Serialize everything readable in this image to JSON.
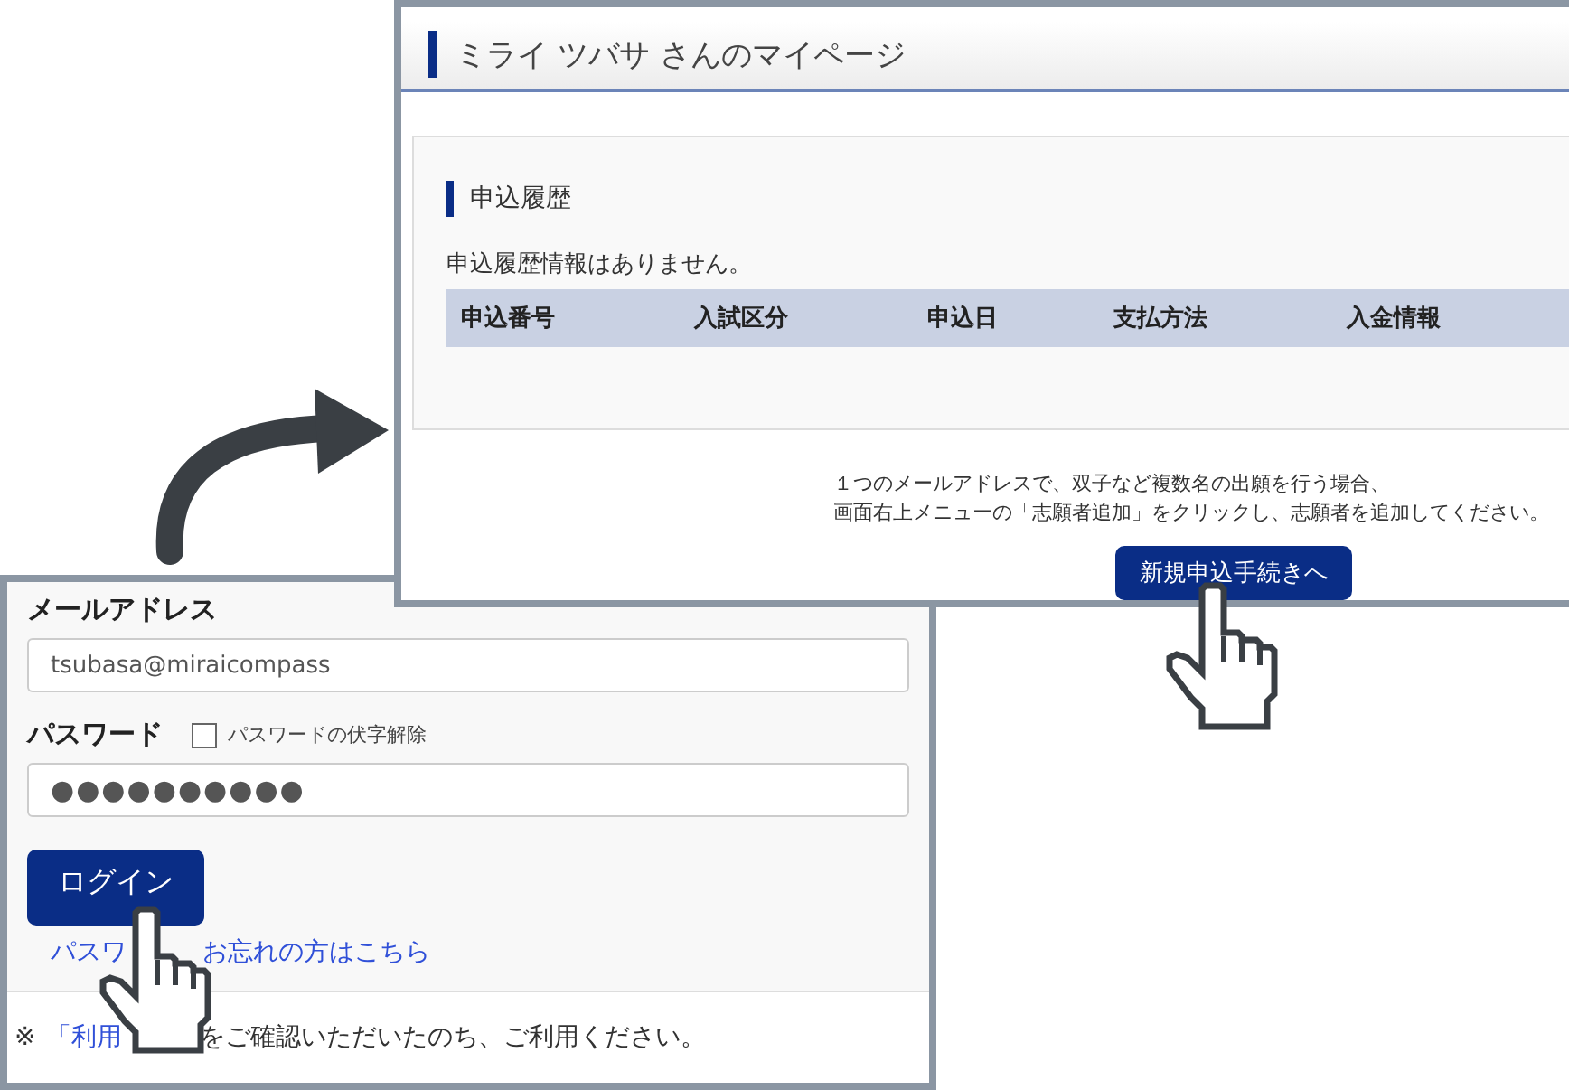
{
  "mypage": {
    "title": "ミライ ツバサ さんのマイページ",
    "section": {
      "heading": "申込履歴",
      "empty_message": "申込履歴情報はありません。",
      "columns": [
        "申込番号",
        "入試区分",
        "申込日",
        "支払方法",
        "入金情報"
      ]
    },
    "note_lines": [
      "１つのメールアドレスで、双子など複数名の出願を行う場合、",
      "画面右上メニューの「志願者追加」をクリックし、志願者を追加してください。"
    ],
    "button": "新規申込手続きへ"
  },
  "login": {
    "email": {
      "label": "メールアドレス",
      "value": "tsubasa@miraicompass"
    },
    "password": {
      "label": "パスワード",
      "show_toggle": {
        "label": "パスワードの伏字解除",
        "checked": false
      },
      "value": "●●●●●●●●●●"
    },
    "login_button": "ログイン",
    "forgot_link_parts": [
      "パスワ",
      "お忘れの方はこちら"
    ],
    "notice": {
      "mark": "※",
      "link_part": "「利用",
      "text": "をご確認いただいたのち、ご利用ください。"
    }
  }
}
